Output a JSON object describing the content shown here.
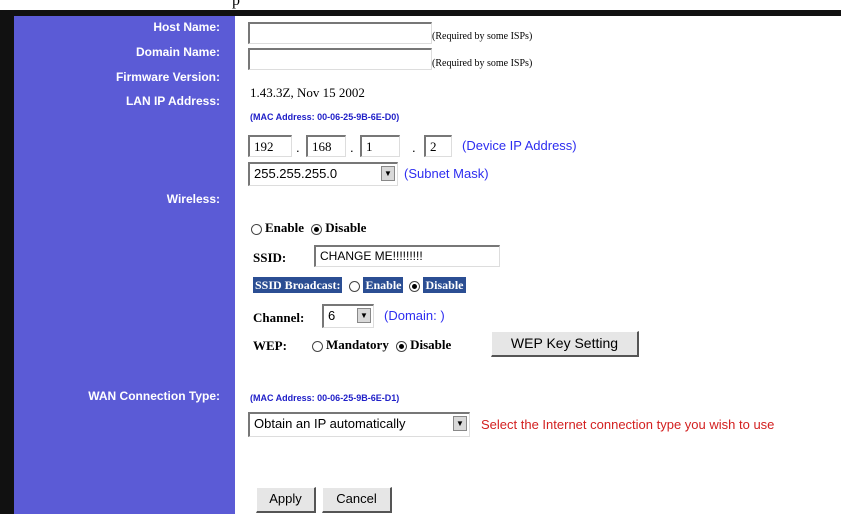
{
  "top_char": "p",
  "labels": {
    "host_name": "Host Name:",
    "domain_name": "Domain Name:",
    "firmware_version": "Firmware Version:",
    "lan_ip": "LAN IP Address:",
    "wireless": "Wireless:",
    "wan_type": "WAN Connection Type:"
  },
  "host_name": {
    "value": "",
    "note": "(Required by some ISPs)"
  },
  "domain_name": {
    "value": "",
    "note": "(Required by some ISPs)"
  },
  "firmware_version": "1.43.3Z, Nov 15 2002",
  "lan": {
    "mac": "(MAC Address: 00-06-25-9B-6E-D0)",
    "ip": [
      "192",
      "168",
      "1",
      "2"
    ],
    "ip_sep": ".",
    "ip_note": "(Device IP Address)",
    "subnet": "255.255.255.0",
    "subnet_note": "(Subnet Mask)"
  },
  "wireless": {
    "enable": "Enable",
    "disable": "Disable",
    "selected": "Disable",
    "ssid_label": "SSID:",
    "ssid_value": "CHANGE ME!!!!!!!!!",
    "broadcast_label": "SSID Broadcast:",
    "broadcast_enable": "Enable",
    "broadcast_disable": "Disable",
    "channel_label": "Channel:",
    "channel_value": "6",
    "domain_note": "(Domain: )",
    "wep_label": "WEP:",
    "wep_mandatory": "Mandatory",
    "wep_disable": "Disable",
    "wep_button": "WEP Key Setting"
  },
  "wan": {
    "mac": "(MAC Address: 00-06-25-9B-6E-D1)",
    "type_value": "Obtain an IP automatically",
    "hint": "Select the Internet connection type you wish to use"
  },
  "buttons": {
    "apply": "Apply",
    "cancel": "Cancel"
  },
  "colors": {
    "sidebar": "#5b5bd6",
    "link_blue": "#2d2df0",
    "hint_red": "#d32020",
    "highlight": "#2b4e93"
  }
}
